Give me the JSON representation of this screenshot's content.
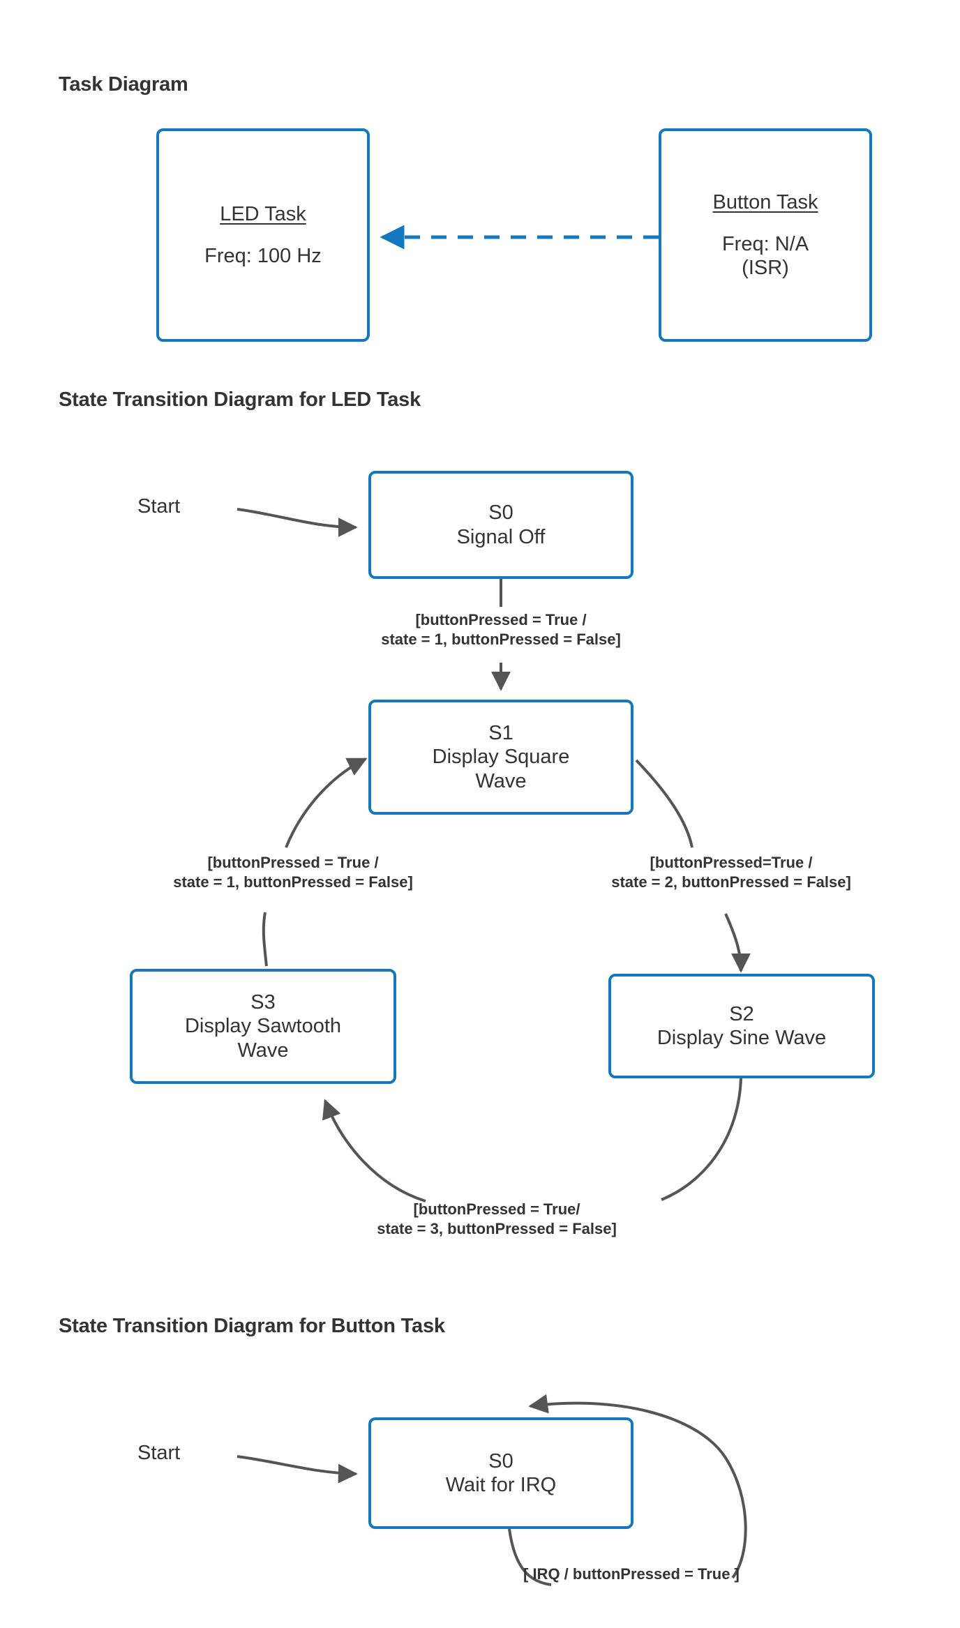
{
  "page": {
    "background": "#ffffff",
    "accent_blue": "#1478BE",
    "edge_gray": "#555555",
    "text_color": "#333333"
  },
  "sections": {
    "task_diagram": {
      "title": "Task Diagram",
      "nodes": {
        "led_task": {
          "title": "LED Task",
          "detail": "Freq: 100 Hz"
        },
        "button_task": {
          "title": "Button Task",
          "detail_line1": "Freq: N/A",
          "detail_line2": "(ISR)"
        }
      },
      "edges": [
        {
          "from": "button_task",
          "to": "led_task",
          "style": "dashed",
          "color": "#1478BE",
          "label": ""
        }
      ]
    },
    "led_state_diagram": {
      "title": "State Transition Diagram for LED Task",
      "start_label": "Start",
      "nodes": {
        "s0": {
          "id": "S0",
          "name": "Signal Off"
        },
        "s1": {
          "id": "S1",
          "name_line1": "Display Square",
          "name_line2": "Wave"
        },
        "s2": {
          "id": "S2",
          "name": "Display Sine Wave"
        },
        "s3": {
          "id": "S3",
          "name_line1": "Display Sawtooth",
          "name_line2": "Wave"
        }
      },
      "transitions": [
        {
          "from": "S0",
          "to": "S1",
          "line1": "[buttonPressed = True /",
          "line2": "state = 1, buttonPressed = False]"
        },
        {
          "from": "S1",
          "to": "S2",
          "line1": "[buttonPressed=True /",
          "line2": "state = 2, buttonPressed = False]"
        },
        {
          "from": "S2",
          "to": "S3",
          "line1": "[buttonPressed = True/",
          "line2": "state = 3, buttonPressed = False]"
        },
        {
          "from": "S3",
          "to": "S1",
          "line1": "[buttonPressed = True /",
          "line2": "state = 1, buttonPressed = False]"
        }
      ]
    },
    "button_state_diagram": {
      "title": "State Transition Diagram for Button Task",
      "start_label": "Start",
      "nodes": {
        "s0": {
          "id": "S0",
          "name": "Wait for IRQ"
        }
      },
      "transitions": [
        {
          "from": "S0",
          "to": "S0",
          "label": "[ IRQ / buttonPressed = True ]"
        }
      ]
    }
  }
}
